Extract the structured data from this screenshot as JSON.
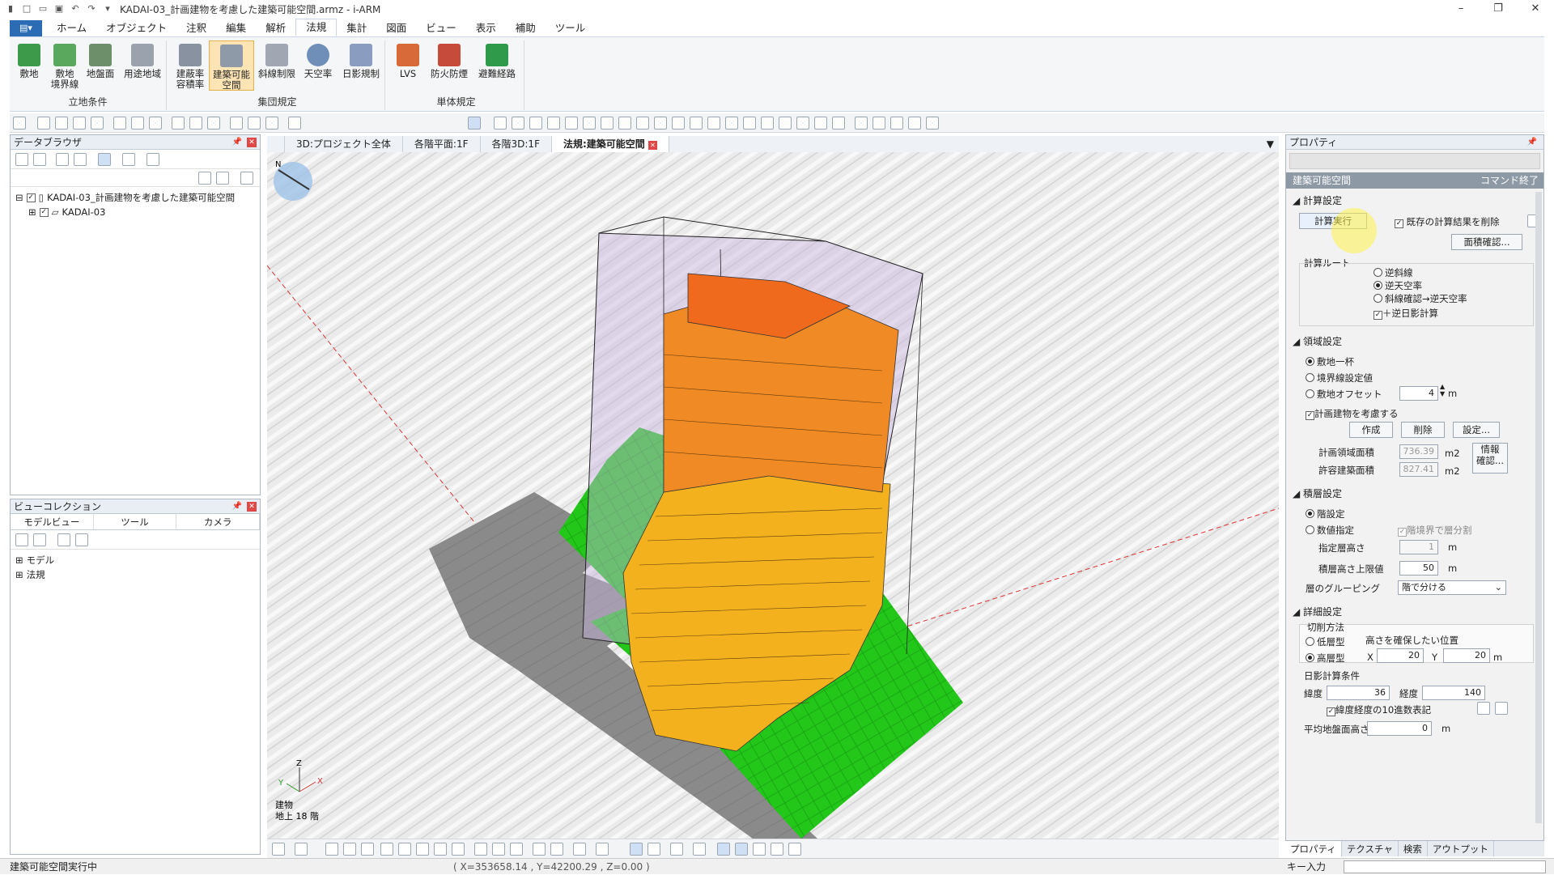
{
  "window": {
    "title": "KADAI-03_計画建物を考慮した建築可能空間.armz - i-ARM"
  },
  "menu": {
    "items": [
      "ホーム",
      "オブジェクト",
      "注釈",
      "編集",
      "解析",
      "法規",
      "集計",
      "図面",
      "ビュー",
      "表示",
      "補助",
      "ツール"
    ],
    "active": "法規"
  },
  "ribbon": {
    "groups": [
      {
        "label": "立地条件",
        "buttons": [
          "敷地",
          "敷地\n境界線",
          "地盤面",
          "用途地域"
        ]
      },
      {
        "label": "集団規定",
        "buttons": [
          "建蔽率\n容積率",
          "建築可能\n空間",
          "斜線制限",
          "天空率",
          "日影規制"
        ]
      },
      {
        "label": "単体規定",
        "buttons": [
          "LVS",
          "防火防煙",
          "避難経路"
        ]
      }
    ],
    "active_button": "建築可能\n空間"
  },
  "data_browser": {
    "title": "データブラウザ",
    "tree": [
      "KADAI-03_計画建物を考慮した建築可能空間",
      "KADAI-03"
    ]
  },
  "view_collection": {
    "title": "ビューコレクション",
    "tabs": [
      "モデルビュー",
      "ツール",
      "カメラ"
    ],
    "tree": [
      "モデル",
      "法規"
    ]
  },
  "view_tabs": {
    "tabs": [
      "3D:プロジェクト全体",
      "各階平面:1F",
      "各階3D:1F",
      "法規:建築可能空間"
    ],
    "active": "法規:建築可能空間"
  },
  "viewport": {
    "axes": {
      "z": "Z",
      "y": "Y",
      "x": "X"
    },
    "info_line1": "建物",
    "info_line2": "地上 18 階",
    "compass": "N"
  },
  "properties": {
    "title": "プロパティ",
    "header": "建築可能空間",
    "command_end": "コマンド終了",
    "calc_section": "計算設定",
    "run_button": "計算実行",
    "delete_existing": "既存の計算結果を削除",
    "area_check": "面積確認...",
    "route_label": "計算ルート",
    "routes": [
      "逆斜線",
      "逆天空率",
      "斜線確認→逆天空率"
    ],
    "route_selected": "逆天空率",
    "inverse_shadow": "＋逆日影計算",
    "region_section": "領域設定",
    "region_options": [
      "敷地一杯",
      "境界線設定値",
      "敷地オフセット"
    ],
    "region_selected": "敷地一杯",
    "offset_value": "4",
    "unit_m": "m",
    "consider_building": "計画建物を考慮する",
    "btn_create": "作成",
    "btn_delete": "削除",
    "btn_settings": "設定...",
    "plan_area_label": "計画領域面積",
    "plan_area": "736.39",
    "allow_area_label": "許容建築面積",
    "allow_area": "827.41",
    "unit_m2": "m2",
    "info_button": "情報\n確認...",
    "stack_section": "積層設定",
    "stack_options": [
      "階設定",
      "数値指定"
    ],
    "stack_selected": "階設定",
    "split_by_floor": "階境界で層分割",
    "floor_height_label": "指定層高さ",
    "floor_height": "1",
    "upper_limit_label": "積層高さ上限値",
    "upper_limit": "50",
    "grouping_label": "層のグルーピング",
    "grouping_value": "階で分ける",
    "detail_section": "詳細設定",
    "cut_label": "切削方法",
    "cut_options": [
      "低層型",
      "高層型"
    ],
    "cut_selected": "高層型",
    "cut_note": "高さを確保したい位置",
    "x_label": "X",
    "x_value": "20",
    "y_label": "Y",
    "y_value": "20",
    "shadow_label": "日影計算条件",
    "lat_label": "緯度",
    "lat_value": "36",
    "lon_label": "経度",
    "lon_value": "140",
    "decimal_label": "緯度経度の10進数表記",
    "avg_ground_label": "平均地盤面高さ",
    "avg_ground": "0"
  },
  "bottom_tabs": [
    "プロパティ",
    "テクスチャ",
    "検索",
    "アウトプット"
  ],
  "status": {
    "left": "建築可能空間実行中",
    "coords": "( X=353658.14 , Y=42200.29 , Z=0.00 )",
    "key_input": "キー入力"
  },
  "colors": {
    "accent": "#2b6cb5",
    "ground": "#22c71a",
    "building_orange": "#f39a1a",
    "building_red": "#e8601e",
    "road": "#8a8a8a"
  }
}
